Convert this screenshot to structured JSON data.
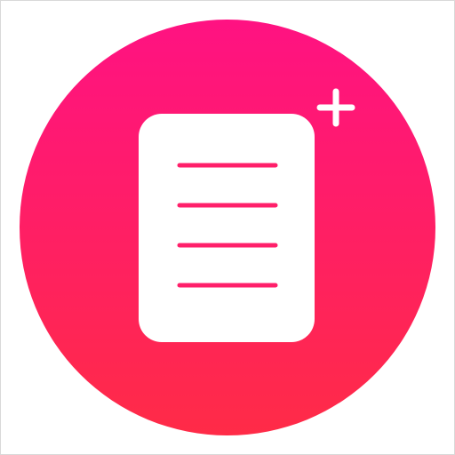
{
  "icon": {
    "name": "new-note-app-icon",
    "glyphs": [
      "document-icon",
      "plus-icon"
    ],
    "colors": {
      "gradient_top": "#ff1282",
      "gradient_bottom": "#ff2b47",
      "document": "#ffffff",
      "document_lines": "#ff1f6a",
      "plus": "#ffffff",
      "border": "#d9d9d9",
      "background": "#ffffff"
    },
    "document_line_count": 4
  }
}
